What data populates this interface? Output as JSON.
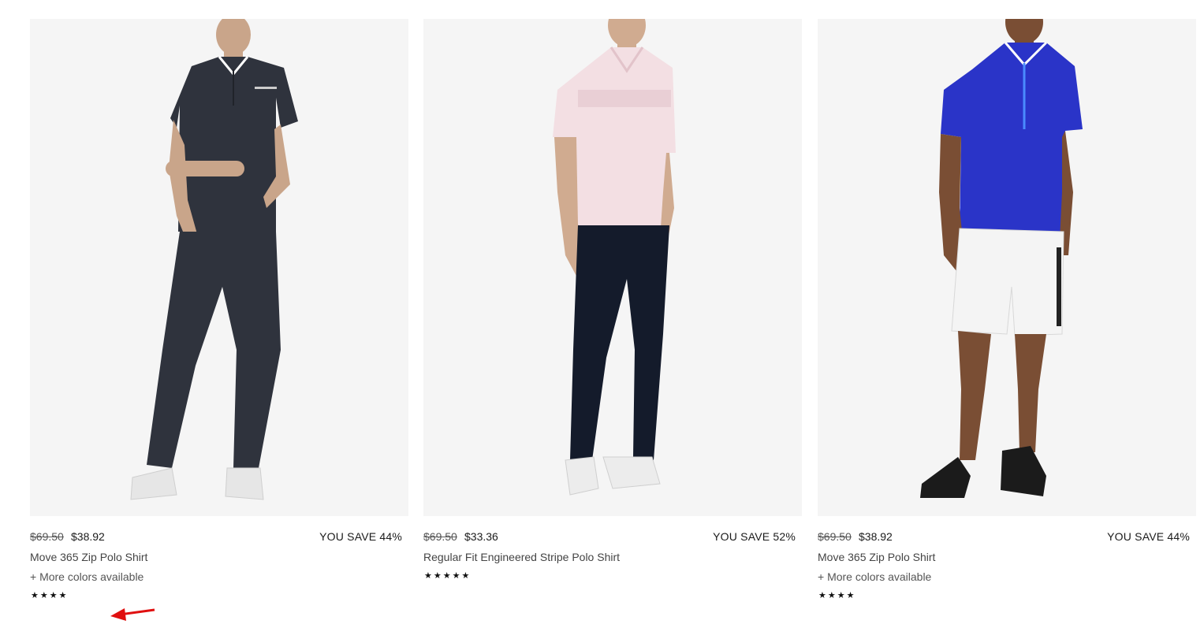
{
  "products": [
    {
      "original_price": "$69.50",
      "sale_price": "$38.92",
      "savings": "YOU SAVE 44%",
      "name": "Move 365 Zip Polo Shirt",
      "more_colors": "+ More colors available",
      "rating_stars": "★★★★",
      "rating": 4
    },
    {
      "original_price": "$69.50",
      "sale_price": "$33.36",
      "savings": "YOU SAVE 52%",
      "name": "Regular Fit Engineered Stripe Polo Shirt",
      "more_colors": "",
      "rating_stars": "★★★★★",
      "rating": 5
    },
    {
      "original_price": "$69.50",
      "sale_price": "$38.92",
      "savings": "YOU SAVE 44%",
      "name": "Move 365 Zip Polo Shirt",
      "more_colors": "+ More colors available",
      "rating_stars": "★★★★",
      "rating": 4
    }
  ],
  "colors": {
    "image_background": "#f5f5f5",
    "charcoal_polo": "#2f333d",
    "pink_polo": "#f3dfe3",
    "blue_polo": "#2a34c8",
    "navy_pants": "#141b2b",
    "white_shorts": "#f4f4f4",
    "annotation_arrow": "#e01010"
  },
  "icons": {
    "annotation": "red-arrow-icon",
    "rating": "star-icon"
  }
}
